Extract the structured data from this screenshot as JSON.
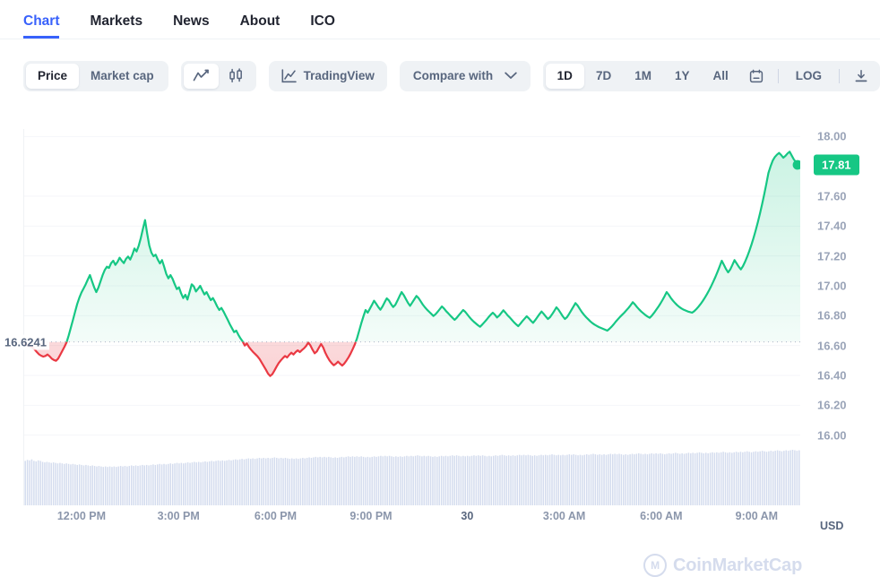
{
  "tabs": [
    {
      "label": "Chart",
      "active": true
    },
    {
      "label": "Markets",
      "active": false
    },
    {
      "label": "News",
      "active": false
    },
    {
      "label": "About",
      "active": false
    },
    {
      "label": "ICO",
      "active": false
    }
  ],
  "toolbar": {
    "metric_toggle": [
      {
        "label": "Price",
        "active": true
      },
      {
        "label": "Market cap",
        "active": false
      }
    ],
    "chart_type_toggle": [
      {
        "icon": "line-chart-icon",
        "active": true
      },
      {
        "icon": "candlestick-icon",
        "active": false
      }
    ],
    "tradingview_label": "TradingView",
    "tradingview_icon": "tradingview-chart-icon",
    "compare_label": "Compare with",
    "compare_icon": "chevron-down-icon",
    "ranges": [
      {
        "label": "1D",
        "active": true
      },
      {
        "label": "7D",
        "active": false
      },
      {
        "label": "1M",
        "active": false
      },
      {
        "label": "1Y",
        "active": false
      },
      {
        "label": "All",
        "active": false
      }
    ],
    "calendar_icon": "calendar-icon",
    "log_label": "LOG",
    "download_icon": "download-icon"
  },
  "chart_data": {
    "type": "area",
    "title": "",
    "xlabel": "",
    "ylabel": "",
    "unit": "USD",
    "currency_label": "USD",
    "ylim": [
      15.95,
      18.05
    ],
    "yticks": [
      "18.00",
      "17.60",
      "17.40",
      "17.20",
      "17.00",
      "16.80",
      "16.60",
      "16.40",
      "16.20",
      "16.00"
    ],
    "ytick_values": [
      18.0,
      17.6,
      17.4,
      17.2,
      17.0,
      16.8,
      16.6,
      16.4,
      16.2,
      16.0
    ],
    "xticks": [
      "12:00 PM",
      "3:00 PM",
      "6:00 PM",
      "9:00 PM",
      "30",
      "3:00 AM",
      "6:00 AM",
      "9:00 AM"
    ],
    "xtick_positions": [
      0.075,
      0.2,
      0.325,
      0.448,
      0.572,
      0.697,
      0.822,
      0.945
    ],
    "xtick_bold_index": 4,
    "grid": true,
    "legend": null,
    "open_price": 16.6241,
    "open_price_label": "16.6241",
    "current_price": 17.81,
    "current_price_label": "17.81",
    "up_color": "#16c784",
    "down_color": "#ea3943",
    "up_fill": "rgba(22,199,132,0.13)",
    "down_fill": "rgba(234,57,67,0.13)",
    "marker": {
      "value": 17.81,
      "color": "#16c784"
    },
    "price_series": [
      16.612,
      16.606,
      16.6,
      16.594,
      16.585,
      16.572,
      16.556,
      16.541,
      16.532,
      16.526,
      16.53,
      16.54,
      16.528,
      16.512,
      16.503,
      16.498,
      16.512,
      16.538,
      16.565,
      16.592,
      16.622,
      16.668,
      16.72,
      16.772,
      16.826,
      16.878,
      16.92,
      16.955,
      16.982,
      17.01,
      17.042,
      17.072,
      17.03,
      16.99,
      16.958,
      16.988,
      17.03,
      17.072,
      17.106,
      17.128,
      17.12,
      17.152,
      17.168,
      17.14,
      17.16,
      17.188,
      17.168,
      17.152,
      17.18,
      17.196,
      17.176,
      17.208,
      17.25,
      17.23,
      17.268,
      17.32,
      17.382,
      17.44,
      17.35,
      17.27,
      17.222,
      17.198,
      17.208,
      17.176,
      17.15,
      17.172,
      17.128,
      17.08,
      17.05,
      17.072,
      17.046,
      17.01,
      16.978,
      16.99,
      16.95,
      16.918,
      16.94,
      16.908,
      16.958,
      17.01,
      16.996,
      16.962,
      16.98,
      17.0,
      16.97,
      16.942,
      16.958,
      16.93,
      16.904,
      16.918,
      16.892,
      16.862,
      16.838,
      16.852,
      16.828,
      16.8,
      16.772,
      16.742,
      16.716,
      16.69,
      16.7,
      16.672,
      16.648,
      16.628,
      16.6,
      16.614,
      16.59,
      16.572,
      16.556,
      16.542,
      16.528,
      16.51,
      16.486,
      16.462,
      16.438,
      16.412,
      16.396,
      16.408,
      16.432,
      16.458,
      16.482,
      16.5,
      16.516,
      16.53,
      16.52,
      16.538,
      16.552,
      16.54,
      16.556,
      16.568,
      16.556,
      16.57,
      16.582,
      16.598,
      16.62,
      16.6,
      16.572,
      16.548,
      16.56,
      16.586,
      16.61,
      16.588,
      16.552,
      16.524,
      16.5,
      16.482,
      16.468,
      16.478,
      16.492,
      16.478,
      16.466,
      16.48,
      16.5,
      16.522,
      16.548,
      16.578,
      16.61,
      16.65,
      16.7,
      16.75,
      16.796,
      16.838,
      16.82,
      16.846,
      16.872,
      16.9,
      16.88,
      16.858,
      16.84,
      16.862,
      16.89,
      16.916,
      16.902,
      16.878,
      16.858,
      16.872,
      16.9,
      16.93,
      16.958,
      16.938,
      16.912,
      16.886,
      16.866,
      16.888,
      16.91,
      16.932,
      16.918,
      16.896,
      16.874,
      16.856,
      16.84,
      16.826,
      16.812,
      16.798,
      16.81,
      16.826,
      16.844,
      16.862,
      16.848,
      16.83,
      16.816,
      16.8,
      16.786,
      16.772,
      16.786,
      16.804,
      16.82,
      16.838,
      16.826,
      16.808,
      16.79,
      16.774,
      16.76,
      16.748,
      16.736,
      16.726,
      16.74,
      16.756,
      16.772,
      16.79,
      16.806,
      16.82,
      16.806,
      16.788,
      16.8,
      16.818,
      16.836,
      16.82,
      16.802,
      16.788,
      16.772,
      16.756,
      16.742,
      16.73,
      16.746,
      16.764,
      16.78,
      16.796,
      16.782,
      16.766,
      16.752,
      16.77,
      16.79,
      16.81,
      16.828,
      16.812,
      16.794,
      16.778,
      16.79,
      16.81,
      16.832,
      16.856,
      16.84,
      16.818,
      16.796,
      16.778,
      16.79,
      16.812,
      16.836,
      16.86,
      16.884,
      16.868,
      16.846,
      16.824,
      16.806,
      16.79,
      16.776,
      16.762,
      16.75,
      16.74,
      16.732,
      16.724,
      16.718,
      16.712,
      16.706,
      16.7,
      16.712,
      16.726,
      16.742,
      16.76,
      16.776,
      16.792,
      16.806,
      16.82,
      16.836,
      16.852,
      16.87,
      16.89,
      16.876,
      16.858,
      16.842,
      16.828,
      16.816,
      16.804,
      16.794,
      16.786,
      16.8,
      16.818,
      16.838,
      16.858,
      16.88,
      16.904,
      16.93,
      16.958,
      16.94,
      16.918,
      16.9,
      16.884,
      16.87,
      16.858,
      16.848,
      16.84,
      16.834,
      16.828,
      16.824,
      16.82,
      16.83,
      16.844,
      16.86,
      16.878,
      16.898,
      16.92,
      16.944,
      16.97,
      16.998,
      17.028,
      17.06,
      17.094,
      17.13,
      17.168,
      17.14,
      17.112,
      17.09,
      17.11,
      17.14,
      17.172,
      17.15,
      17.128,
      17.11,
      17.132,
      17.162,
      17.196,
      17.234,
      17.276,
      17.322,
      17.372,
      17.426,
      17.484,
      17.546,
      17.612,
      17.682,
      17.756,
      17.8,
      17.838,
      17.862,
      17.878,
      17.89,
      17.876,
      17.858,
      17.87,
      17.886,
      17.898,
      17.872,
      17.846,
      17.828,
      17.818,
      17.81
    ],
    "volume_series": [
      0.88,
      0.9,
      0.89,
      0.91,
      0.88,
      0.87,
      0.89,
      0.88,
      0.86,
      0.85,
      0.86,
      0.85,
      0.84,
      0.85,
      0.84,
      0.83,
      0.84,
      0.83,
      0.82,
      0.83,
      0.82,
      0.81,
      0.82,
      0.81,
      0.8,
      0.81,
      0.8,
      0.79,
      0.8,
      0.79,
      0.78,
      0.79,
      0.78,
      0.77,
      0.78,
      0.77,
      0.76,
      0.77,
      0.76,
      0.77,
      0.76,
      0.77,
      0.76,
      0.77,
      0.78,
      0.77,
      0.78,
      0.77,
      0.78,
      0.79,
      0.78,
      0.79,
      0.78,
      0.79,
      0.8,
      0.79,
      0.8,
      0.79,
      0.8,
      0.81,
      0.8,
      0.81,
      0.82,
      0.81,
      0.82,
      0.81,
      0.82,
      0.83,
      0.82,
      0.83,
      0.84,
      0.83,
      0.84,
      0.83,
      0.84,
      0.85,
      0.84,
      0.85,
      0.86,
      0.85,
      0.86,
      0.85,
      0.86,
      0.87,
      0.86,
      0.87,
      0.88,
      0.87,
      0.88,
      0.89,
      0.88,
      0.89,
      0.88,
      0.89,
      0.9,
      0.89,
      0.9,
      0.91,
      0.9,
      0.91,
      0.92,
      0.91,
      0.92,
      0.93,
      0.92,
      0.93,
      0.92,
      0.93,
      0.94,
      0.93,
      0.94,
      0.93,
      0.94,
      0.93,
      0.94,
      0.95,
      0.94,
      0.93,
      0.94,
      0.93,
      0.94,
      0.93,
      0.92,
      0.93,
      0.92,
      0.93,
      0.92,
      0.93,
      0.94,
      0.93,
      0.94,
      0.95,
      0.94,
      0.95,
      0.96,
      0.95,
      0.96,
      0.95,
      0.96,
      0.95,
      0.96,
      0.95,
      0.94,
      0.95,
      0.94,
      0.95,
      0.96,
      0.95,
      0.96,
      0.97,
      0.96,
      0.97,
      0.96,
      0.97,
      0.96,
      0.97,
      0.96,
      0.95,
      0.96,
      0.95,
      0.96,
      0.97,
      0.96,
      0.97,
      0.98,
      0.97,
      0.98,
      0.97,
      0.98,
      0.97,
      0.96,
      0.97,
      0.96,
      0.97,
      0.96,
      0.97,
      0.98,
      0.97,
      0.98,
      0.97,
      0.98,
      0.99,
      0.98,
      0.97,
      0.98,
      0.97,
      0.98,
      0.97,
      0.96,
      0.97,
      0.96,
      0.97,
      0.98,
      0.97,
      0.98,
      0.97,
      0.98,
      0.99,
      0.98,
      0.99,
      0.98,
      0.97,
      0.98,
      0.97,
      0.98,
      0.97,
      0.98,
      0.99,
      0.98,
      0.99,
      0.98,
      0.99,
      0.98,
      0.97,
      0.98,
      0.97,
      0.98,
      0.99,
      0.98,
      0.99,
      1.0,
      0.99,
      0.98,
      0.99,
      0.98,
      0.99,
      0.98,
      0.99,
      1.0,
      0.99,
      1.0,
      0.99,
      1.0,
      0.99,
      0.98,
      0.99,
      0.98,
      0.99,
      1.0,
      0.99,
      1.0,
      0.99,
      1.0,
      1.01,
      1.0,
      0.99,
      1.0,
      0.99,
      1.0,
      0.99,
      1.0,
      1.01,
      1.0,
      1.01,
      1.0,
      0.99,
      1.0,
      0.99,
      1.0,
      1.01,
      1.0,
      1.01,
      1.02,
      1.01,
      1.0,
      1.01,
      1.0,
      1.01,
      1.0,
      1.01,
      1.02,
      1.01,
      1.02,
      1.01,
      1.02,
      1.01,
      1.0,
      1.01,
      1.0,
      1.01,
      1.02,
      1.01,
      1.02,
      1.03,
      1.02,
      1.01,
      1.02,
      1.01,
      1.02,
      1.03,
      1.02,
      1.03,
      1.02,
      1.03,
      1.02,
      1.01,
      1.02,
      1.03,
      1.02,
      1.03,
      1.04,
      1.03,
      1.02,
      1.03,
      1.02,
      1.03,
      1.04,
      1.03,
      1.04,
      1.03,
      1.04,
      1.05,
      1.04,
      1.03,
      1.04,
      1.03,
      1.04,
      1.05,
      1.04,
      1.05,
      1.04,
      1.05,
      1.06,
      1.05,
      1.04,
      1.05,
      1.04,
      1.05,
      1.06,
      1.05,
      1.06,
      1.05,
      1.06,
      1.07,
      1.06,
      1.05,
      1.06,
      1.07,
      1.06,
      1.07,
      1.08,
      1.07,
      1.06,
      1.07,
      1.08,
      1.07,
      1.08,
      1.09,
      1.08,
      1.07,
      1.08,
      1.09,
      1.08,
      1.09,
      1.1,
      1.09,
      1.08,
      1.09
    ]
  },
  "watermark": {
    "text": "CoinMarketCap",
    "logo": "coinmarketcap-logo"
  }
}
